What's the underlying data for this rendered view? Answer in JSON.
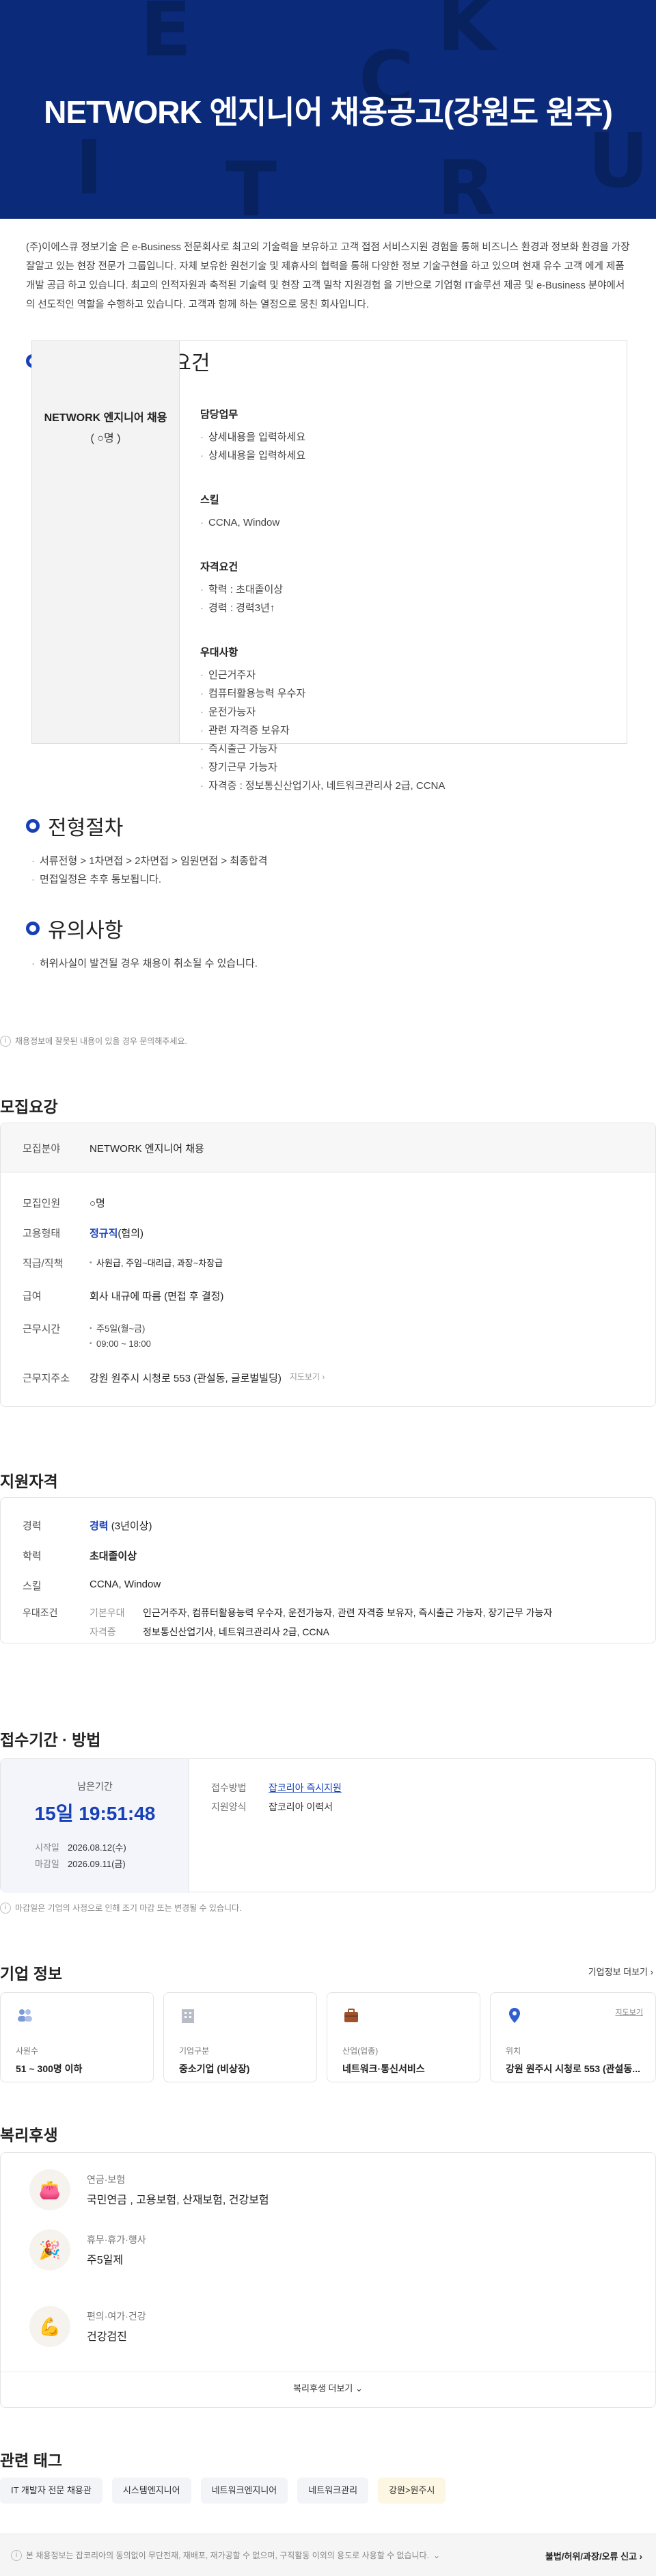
{
  "hero": {
    "title": "NETWORK 엔지니어 채용공고(강원도 원주)",
    "deco_letters": [
      "E",
      "C",
      "R",
      "I",
      "U",
      "T",
      "R",
      "K"
    ]
  },
  "intro": "(주)이에스큐 정보기술 은 e-Business 전문회사로 최고의 기술력을 보유하고 고객 접점 서비스지원 경험을 통해 비즈니스 환경과 정보화 환경을 가장 잘알고 있는 현장 전문가 그룹입니다. 자체 보유한 원천기술 및 제휴사의 협력을 통해 다양한 정보 기술구현을 하고 있으며 현재 유수 고객 에게 제품 개발 공급 하고 있습니다. 최고의 인적자원과 축적된 기술력 및 현장 고객 밀착 지원경험 을 기반으로 기업형 IT솔루션 제공 및 e-Business 분야에서의 선도적인 역할을 수행하고 있습니다. 고객과 함께 하는 열정으로 뭉친 회사입니다.",
  "position": {
    "heading": "포지션 및 자격요건",
    "title": "NETWORK 엔지니어 채용",
    "headcount": "( ○명 )",
    "groups": [
      {
        "title": "담당업무",
        "items": [
          "상세내용을 입력하세요",
          "상세내용을 입력하세요"
        ]
      },
      {
        "title": "스킬",
        "items": [
          "CCNA, Window"
        ]
      },
      {
        "title": "자격요건",
        "items": [
          "학력 : 초대졸이상",
          "경력 : 경력3년↑"
        ]
      },
      {
        "title": "우대사항",
        "items": [
          "인근거주자",
          "컴퓨터활용능력 우수자",
          "운전가능자",
          "관련 자격증 보유자",
          "즉시출근 가능자",
          "장기근무 가능자",
          "자격증 : 정보통신산업기사, 네트워크관리사 2급, CCNA"
        ]
      }
    ]
  },
  "process": {
    "heading": "전형절차",
    "items": [
      "서류전형 > 1차면접 > 2차면접 > 임원면접 > 최종합격",
      "면접일정은 추후 통보됩니다."
    ]
  },
  "caution": {
    "heading": "유의사항",
    "items": [
      "허위사실이 발견될 경우 채용이 취소될 수 있습니다."
    ]
  },
  "report_note": "채용정보에 잘못된 내용이 있을 경우 문의해주세요.",
  "recruit": {
    "heading": "모집요강",
    "field_label": "모집분야",
    "field_value": "NETWORK 엔지니어 채용",
    "count_label": "모집인원",
    "count_value": "○명",
    "type_label": "고용형태",
    "type_value": "정규직",
    "type_suffix": "(협의)",
    "rank_label": "직급/직책",
    "rank_value": "사원급, 주임~대리급, 과장~차장급",
    "salary_label": "급여",
    "salary_value": "회사 내규에 따름 (면접 후 결정)",
    "hours_label": "근무시간",
    "hours_values": [
      "주5일(월~금)",
      "09:00 ~ 18:00"
    ],
    "addr_label": "근무지주소",
    "addr_value": "강원 원주시 시청로 553 (관설동, 글로벌빌딩)",
    "map_link": "지도보기"
  },
  "qualify": {
    "heading": "지원자격",
    "career_label": "경력",
    "career_value": "경력",
    "career_suffix": "(3년이상)",
    "edu_label": "학력",
    "edu_value": "초대졸이상",
    "skill_label": "스킬",
    "skill_value": "CCNA, Window",
    "pref_label": "우대조건",
    "basic_label": "기본우대",
    "basic_value": "인근거주자, 컴퓨터활용능력 우수자, 운전가능자, 관련 자격증 보유자, 즉시출근 가능자, 장기근무 가능자",
    "cert_label": "자격증",
    "cert_value": "정보통신산업기사, 네트워크관리사 2급, CCNA"
  },
  "apply": {
    "heading": "접수기간 · 방법",
    "remain_label": "남은기간",
    "remain_value": "15일 19:51:48",
    "start_label": "시작일",
    "start_value": "2026.08.12(수)",
    "end_label": "마감일",
    "end_value": "2026.09.11(금)",
    "method_label": "접수방법",
    "method_value": "잡코리아 즉시지원",
    "form_label": "지원양식",
    "form_value": "잡코리아 이력서",
    "note": "마감일은 기업의 사정으로 인해 조기 마감 또는 변경될 수 있습니다."
  },
  "company": {
    "heading": "기업 정보",
    "more": "기업정보 더보기",
    "cards": [
      {
        "label": "사원수",
        "value": "51 ~ 300명 이하",
        "icon": "people-icon"
      },
      {
        "label": "기업구분",
        "value": "중소기업 (비상장)",
        "icon": "building-icon"
      },
      {
        "label": "산업(업종)",
        "value": "네트워크·통신서비스",
        "icon": "briefcase-icon"
      },
      {
        "label": "위치",
        "value": "강원 원주시 시청로 553 (관설동...",
        "icon": "location-icon",
        "link": "지도보기"
      }
    ]
  },
  "welfare": {
    "heading": "복리후생",
    "items": [
      {
        "cat": "연금·보험",
        "val": "국민연금 , 고용보험, 산재보험, 건강보험",
        "icon": "wallet-icon"
      },
      {
        "cat": "휴무·휴가·행사",
        "val": "주5일제",
        "icon": "party-icon"
      },
      {
        "cat": "편의·여가·건강",
        "val": "건강검진",
        "icon": "health-icon"
      }
    ],
    "more": "복리후생 더보기"
  },
  "tags": {
    "heading": "관련 태그",
    "items": [
      "IT 개발자 전문 채용관",
      "시스템엔지니어",
      "네트워크엔지니어",
      "네트워크관리",
      "강원>원주시"
    ]
  },
  "footer": {
    "notice": "본 채용정보는 잡코리아의 동의없이 무단전재, 재배포, 재가공할 수 없으며, 구직활동 이외의 용도로 사용할 수 없습니다.",
    "report": "불법/허위/과장/오류 신고"
  },
  "colors": {
    "hero_bg": "#0b2a7a",
    "accent": "#1740b8"
  }
}
